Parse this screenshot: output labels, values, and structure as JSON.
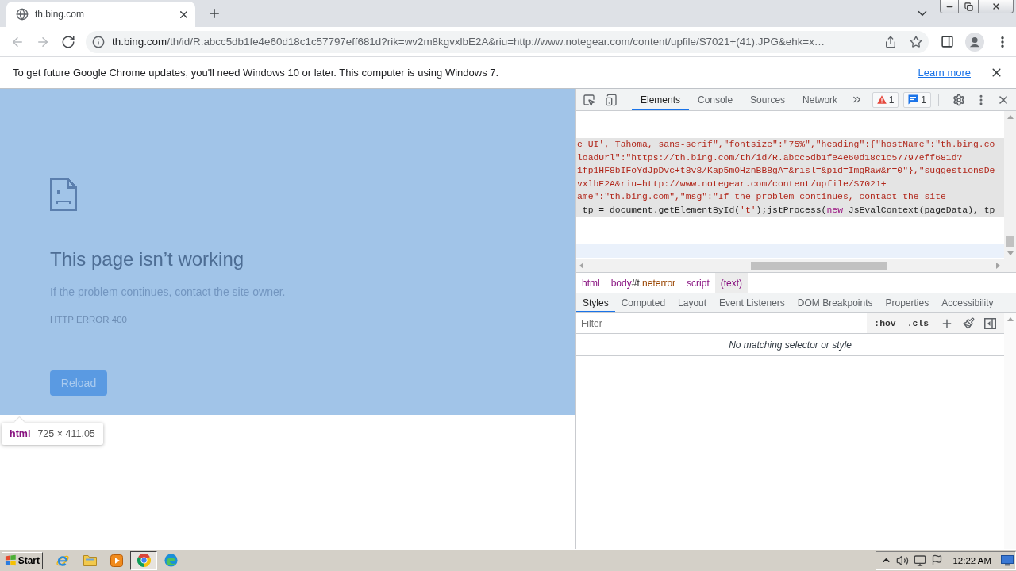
{
  "browser": {
    "tabs": [
      {
        "title": "th.bing.com",
        "selected": true
      }
    ],
    "nav_buttons": [
      {
        "kind": "back",
        "disabled": true
      },
      {
        "kind": "forward",
        "disabled": true
      },
      {
        "kind": "reload",
        "disabled": false
      }
    ],
    "address_bar": {
      "host": "th.bing.com",
      "path": "/th/id/R.abcc5db1fe4e60d18c1c57797eff681d?rik=wv2m8kgvxlbE2A&riu=http://www.notegear.com/content/upfile/S7021+(41).JPG&ehk=x…"
    },
    "infobar": {
      "message": "To get future Google Chrome updates, you'll need Windows 10 or later. This computer is using Windows 7.",
      "link": "Learn more"
    }
  },
  "page": {
    "highlighted": true,
    "title": "This page isn’t working",
    "message": "If the problem continues, contact the site owner.",
    "error_code": "HTTP ERROR 400",
    "button": "Reload",
    "inspect_tooltip": {
      "tag": "html",
      "size": "725 × 411.05"
    }
  },
  "devtools": {
    "tabs": [
      {
        "label": "Elements",
        "selected": true
      },
      {
        "label": "Console",
        "selected": false
      },
      {
        "label": "Sources",
        "selected": false
      },
      {
        "label": "Network",
        "selected": false
      }
    ],
    "badges": [
      {
        "kind": "warning",
        "count": "1"
      },
      {
        "kind": "message",
        "count": "1"
      }
    ],
    "code_lines": [
      {
        "selected": true,
        "tokens": [
          {
            "kind": "string",
            "text": "e UI', Tahoma, sans-serif\",\"fontsize\":\"75%\",\"heading\":{\"hostName\":\"th.bing.co"
          }
        ]
      },
      {
        "selected": true,
        "tokens": [
          {
            "kind": "string",
            "text": "loadUrl\":\"https://th.bing.com/th/id/R.abcc5db1fe4e60d18c1c57797eff681d?"
          }
        ]
      },
      {
        "selected": true,
        "tokens": [
          {
            "kind": "string",
            "text": "1fp1HF8bIFoYdJpDvc+t8v8/Kap5m0HznBB8gA=&risl=&pid=ImgRaw&r=0\"},\"suggestionsDe"
          }
        ]
      },
      {
        "selected": true,
        "tokens": [
          {
            "kind": "string",
            "text": "vxlbE2A&riu=http://www.notegear.com/content/upfile/S7021+"
          }
        ]
      },
      {
        "selected": true,
        "tokens": [
          {
            "kind": "string",
            "text": "ame\":\"th.bing.com\",\"msg\":\"If the problem continues, contact the site"
          }
        ]
      },
      {
        "selected": true,
        "tokens": [
          {
            "kind": "plain",
            "text": " tp = document.getElementById("
          },
          {
            "kind": "string",
            "text": "'t'"
          },
          {
            "kind": "plain",
            "text": ");jstProcess("
          },
          {
            "kind": "keyword",
            "text": "new"
          },
          {
            "kind": "plain",
            "text": " JsEvalContext(pageData), tp"
          }
        ]
      }
    ],
    "breadcrumbs": [
      {
        "tag": "html",
        "selected": false
      },
      {
        "tag": "body",
        "id": "#t",
        "class": ".neterror",
        "selected": false
      },
      {
        "tag": "script",
        "selected": false
      },
      {
        "tag": "(text)",
        "selected": true
      }
    ],
    "sidebar_tabs": [
      {
        "label": "Styles",
        "selected": true
      },
      {
        "label": "Computed",
        "selected": false
      },
      {
        "label": "Layout",
        "selected": false
      },
      {
        "label": "Event Listeners",
        "selected": false
      },
      {
        "label": "DOM Breakpoints",
        "selected": false
      },
      {
        "label": "Properties",
        "selected": false
      },
      {
        "label": "Accessibility",
        "selected": false
      }
    ],
    "filter": {
      "placeholder": "Filter",
      "toggles": [
        ":hov",
        ".cls"
      ]
    },
    "empty_message": "No matching selector or style"
  },
  "taskbar": {
    "start": "Start",
    "apps": [
      {
        "kind": "ie",
        "active": false
      },
      {
        "kind": "folder",
        "active": false
      },
      {
        "kind": "media",
        "active": false
      },
      {
        "kind": "chrome",
        "active": true
      },
      {
        "kind": "edge",
        "active": false
      }
    ],
    "clock": "12:22 AM"
  }
}
